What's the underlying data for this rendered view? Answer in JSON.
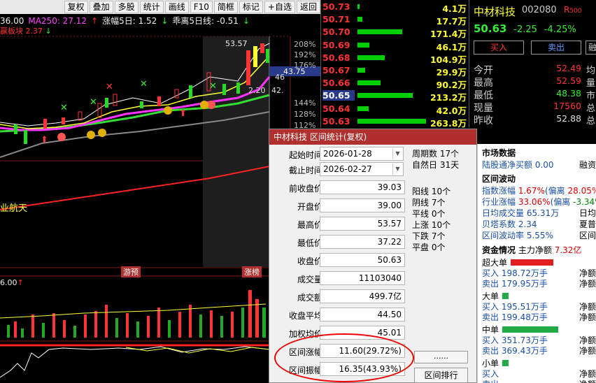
{
  "chart_toolbar": [
    "复权",
    "叠加",
    "多股",
    "统计",
    "画线",
    "F10",
    "简框",
    "标记",
    "+自选",
    "返回"
  ],
  "chart_info": {
    "price": "36.00",
    "ma250": "MA250: 27.12",
    "ma250_arrow": "↑",
    "zf_label": "涨幅5日: 1.52",
    "zf_arrow": "↓",
    "gl_label": "乖离5日线: -0.51",
    "gl_arrow": "↓",
    "sub_label": "赢板块",
    "sub_value": "2.37",
    "sub_arrow": "↓"
  },
  "chart_labels": {
    "peak": "53.57",
    "current_tag": "43.75",
    "pct_208": "208%",
    "pct_192": "192%",
    "pct_176": "176%",
    "pct_144": "144%",
    "pct_128": "128%",
    "pct_112": "112%",
    "side_46": "46",
    "side_42": "42.",
    "side_220": "2.20",
    "ind_label": "业航天",
    "tag_left": "游预",
    "tag_right": "涨榜",
    "vol_label": "6.00",
    "vol_arrow": "↑"
  },
  "order_book": [
    {
      "price": "50.73",
      "volume": "4.1万",
      "bar": 0.02
    },
    {
      "price": "50.71",
      "volume": "17.7万",
      "bar": 0.07
    },
    {
      "price": "50.70",
      "volume": "171.4万",
      "bar": 0.65
    },
    {
      "price": "50.69",
      "volume": "46.1万",
      "bar": 0.17
    },
    {
      "price": "50.68",
      "volume": "104.9万",
      "bar": 0.4
    },
    {
      "price": "50.67",
      "volume": "29.9万",
      "bar": 0.11
    },
    {
      "price": "50.66",
      "volume": "90.2万",
      "bar": 0.34
    },
    {
      "price": "50.65",
      "volume": "213.2万",
      "bar": 0.81,
      "highlight": true
    },
    {
      "price": "50.64",
      "volume": "42.0万",
      "bar": 0.16
    },
    {
      "price": "50.63",
      "volume": "263.8万",
      "bar": 1.0
    }
  ],
  "quote": {
    "name": "中材科技",
    "code": "002080",
    "r_mark": "R",
    "r_sub": "500",
    "price": "50.63",
    "change": "-2.25",
    "pct": "-4.25%",
    "buy": "买入",
    "sell": "卖出",
    "more": "融",
    "stats": [
      {
        "label": "今开",
        "value": "52.49",
        "trail": "均"
      },
      {
        "label": "最高",
        "value": "52.59",
        "trail": "量"
      },
      {
        "label": "最低",
        "value": "48.38",
        "trail": "市"
      },
      {
        "label": "现量",
        "value": "17560",
        "trail": "总"
      },
      {
        "label": "昨收",
        "value": "52.88",
        "trail": "总"
      }
    ]
  },
  "dialog": {
    "title": "中材科技 区间统计(复权)",
    "start_label": "起始时间",
    "start_value": "2026-01-28",
    "end_label": "截止时间",
    "end_value": "2026-02-27",
    "rows": [
      {
        "label": "前收盘价",
        "value": "39.03"
      },
      {
        "label": "开盘价",
        "value": "39.00"
      },
      {
        "label": "最高价",
        "value": "53.57"
      },
      {
        "label": "最低价",
        "value": "37.22"
      },
      {
        "label": "收盘价",
        "value": "50.63"
      },
      {
        "label": "成交量",
        "value": "11103040"
      },
      {
        "label": "成交额",
        "value": "499.7亿"
      },
      {
        "label": "收盘平均",
        "value": "44.50"
      },
      {
        "label": "加权均价",
        "value": "45.01"
      },
      {
        "label": "区间涨幅",
        "value": "11.60(29.72%)"
      },
      {
        "label": "区间振幅",
        "value": "16.35(43.93%)"
      }
    ],
    "right_top": [
      "周期数 17个",
      "自然日 31天"
    ],
    "right_mid": [
      "阳线 10个",
      "阴线 7个",
      "平线 0个",
      "上涨 10个",
      "下跌 7个",
      "平盘 0个"
    ],
    "dots_btn": "......",
    "rank_btn": "区间排行"
  },
  "data_panel": {
    "market_title": "市场数据",
    "hk_label": "陆股通净买额",
    "hk_value": "0.00",
    "margin_label": "融资",
    "wave_title": "区间波动",
    "idx_label": "指数涨幅",
    "idx_value": "1.67%",
    "idx_dev": "(偏离",
    "idx_dev_value": "28.05%)",
    "ind_label": "行业涨幅",
    "ind_value": "33.06%",
    "ind_dev": "(偏离",
    "ind_dev_value": "-3.34%",
    "avg_label": "日均成交量",
    "avg_value": "65.31万",
    "avg_trail": "日均",
    "beta_label": "贝塔系数",
    "beta_value": "2.34",
    "beta_trail": "夏普",
    "vol_label": "区间波动率",
    "vol_value": "5.55%",
    "vol_trail": "区间",
    "fund_title": "资金情况",
    "main_label": "主力净额",
    "main_value": "7.32亿",
    "groups": [
      {
        "name": "超大单",
        "buy": "198.72万手",
        "sell": "179.95万手",
        "bar_color": "#e02020",
        "bar": 0.52
      },
      {
        "name": "大单",
        "buy": "195.51万手",
        "sell": "199.48万手",
        "bar_color": "#22aa44",
        "bar": 0.08
      },
      {
        "name": "中单",
        "buy": "351.73万手",
        "sell": "369.43万手",
        "bar_color": "#22aa44",
        "bar": 0.68
      },
      {
        "name": "小单",
        "buy": "",
        "sell": "",
        "bar_color": "#22aa44",
        "bar": 0.08
      }
    ],
    "buy_label": "买入",
    "sell_label": "卖出",
    "net_label": "净额"
  }
}
